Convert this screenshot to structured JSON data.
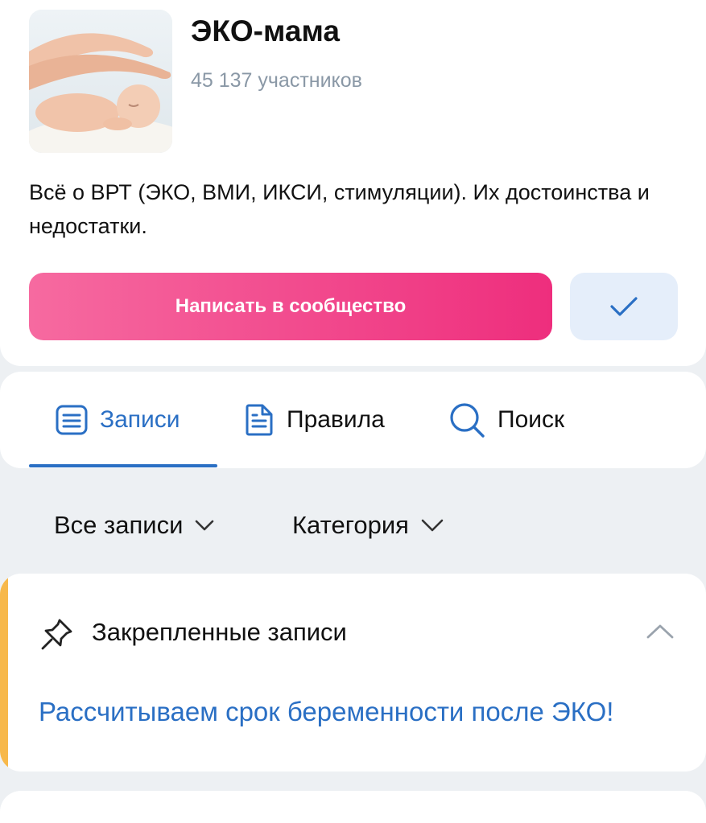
{
  "group": {
    "name": "ЭКО-мама",
    "members": "45 137 участников",
    "description": "Всё о ВРТ (ЭКО, ВМИ, ИКСИ, стимуляции). Их достоинства и недостатки."
  },
  "actions": {
    "write_label": "Написать в сообщество",
    "subscribed_icon": "check-icon"
  },
  "tabs": [
    {
      "label": "Записи",
      "icon": "posts-icon",
      "active": true
    },
    {
      "label": "Правила",
      "icon": "document-icon",
      "active": false
    },
    {
      "label": "Поиск",
      "icon": "search-icon",
      "active": false
    }
  ],
  "filters": {
    "all_posts": "Все записи",
    "category": "Категория"
  },
  "pinned": {
    "title": "Закрепленные записи",
    "post_title": "Рассчитываем срок беременности после ЭКО!"
  },
  "colors": {
    "accent_blue": "#2a6fc4",
    "button_pink_start": "#f66aa0",
    "button_pink_end": "#ee2e7d",
    "pinned_accent": "#f7b84a",
    "page_bg": "#edf0f3"
  }
}
